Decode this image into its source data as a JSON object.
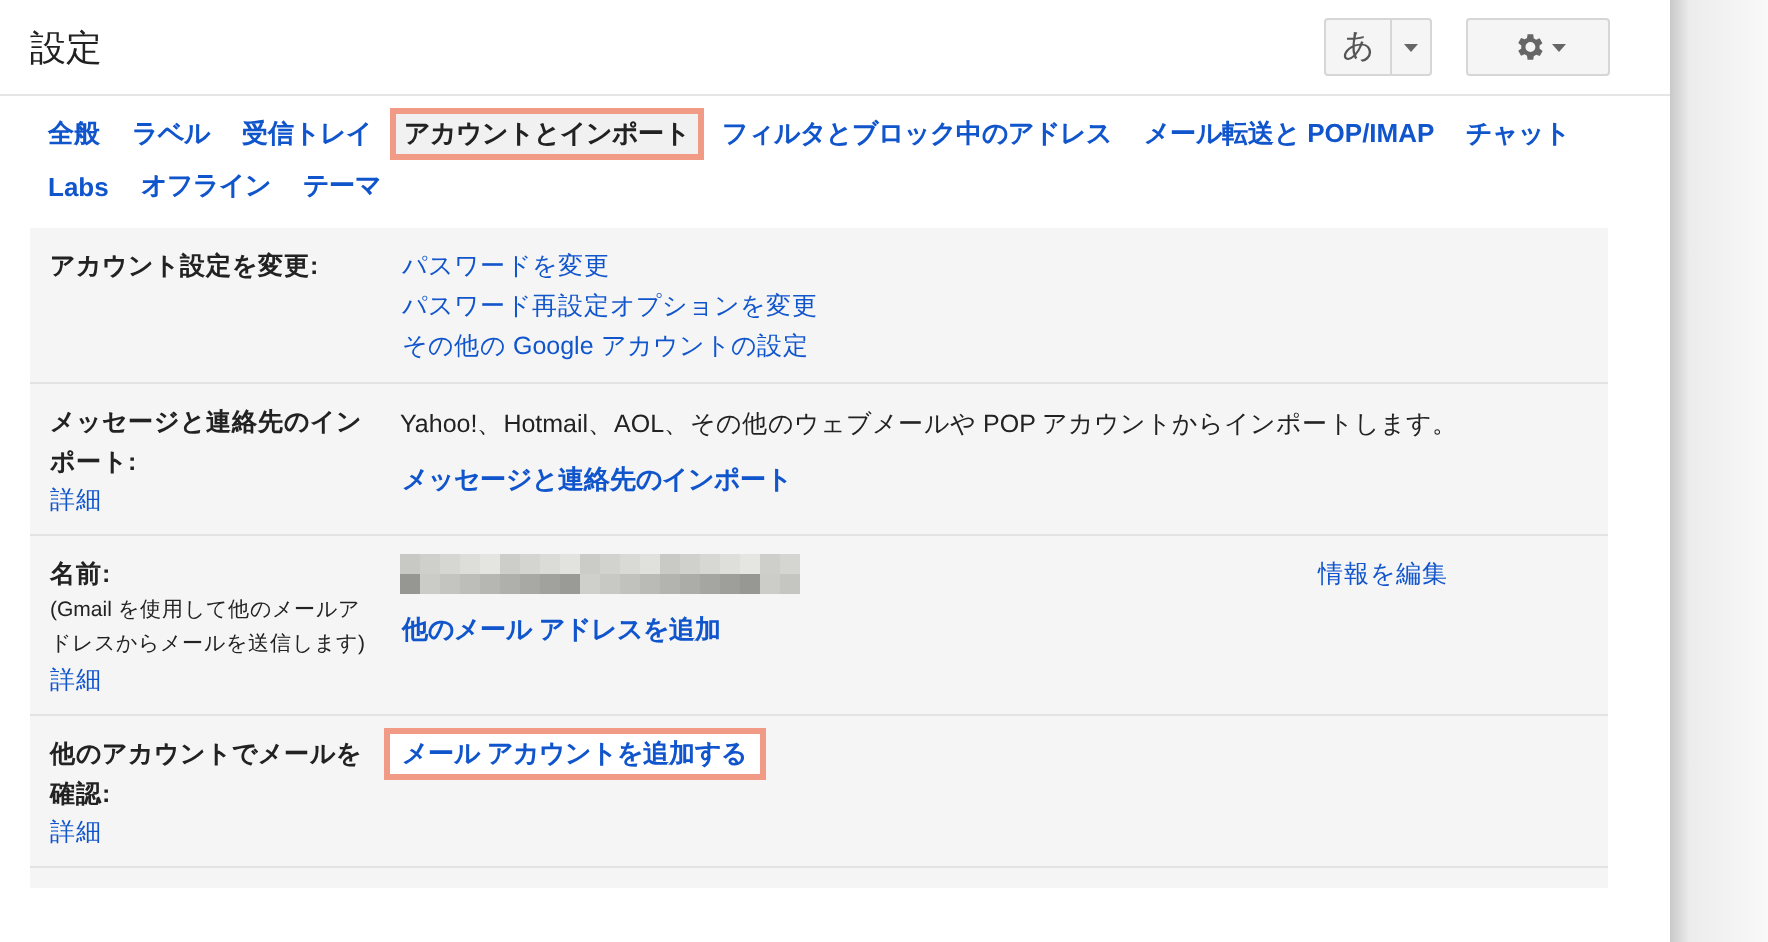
{
  "title": "設定",
  "input_button": {
    "label": "あ"
  },
  "tabs": [
    {
      "label": "全般",
      "selected": false,
      "highlighted": false
    },
    {
      "label": "ラベル",
      "selected": false,
      "highlighted": false
    },
    {
      "label": "受信トレイ",
      "selected": false,
      "highlighted": false
    },
    {
      "label": "アカウントとインポート",
      "selected": true,
      "highlighted": true
    },
    {
      "label": "フィルタとブロック中のアドレス",
      "selected": false,
      "highlighted": false
    },
    {
      "label": "メール転送と POP/IMAP",
      "selected": false,
      "highlighted": false
    },
    {
      "label": "チャット",
      "selected": false,
      "highlighted": false
    },
    {
      "label": "Labs",
      "selected": false,
      "highlighted": false
    },
    {
      "label": "オフライン",
      "selected": false,
      "highlighted": false
    },
    {
      "label": "テーマ",
      "selected": false,
      "highlighted": false
    }
  ],
  "rows": [
    {
      "label": "アカウント設定を変更:",
      "links": [
        {
          "text": "パスワードを変更",
          "kind": "plain",
          "highlighted": false
        },
        {
          "text": "パスワード再設定オプションを変更",
          "kind": "plain",
          "highlighted": false
        },
        {
          "text": "その他の Google アカウントの設定",
          "kind": "plain",
          "highlighted": false
        }
      ]
    },
    {
      "label": "メッセージと連絡先のインポート:",
      "help": "詳細",
      "description": "Yahoo!、Hotmail、AOL、その他のウェブメールや POP アカウントからインポートします。",
      "links": [
        {
          "text": "メッセージと連絡先のインポート",
          "kind": "bold",
          "highlighted": false
        }
      ]
    },
    {
      "label": "名前:",
      "note": "(Gmail を使用して他のメールアドレスからメールを送信します)",
      "help": "詳細",
      "redacted": true,
      "edit_link": "情報を編集",
      "links": [
        {
          "text": "他のメール アドレスを追加",
          "kind": "bold",
          "highlighted": false
        }
      ]
    },
    {
      "label": "他のアカウントでメールを確認:",
      "help": "詳細",
      "links": [
        {
          "text": "メール アカウントを追加する",
          "kind": "bold",
          "highlighted": true
        }
      ]
    }
  ]
}
